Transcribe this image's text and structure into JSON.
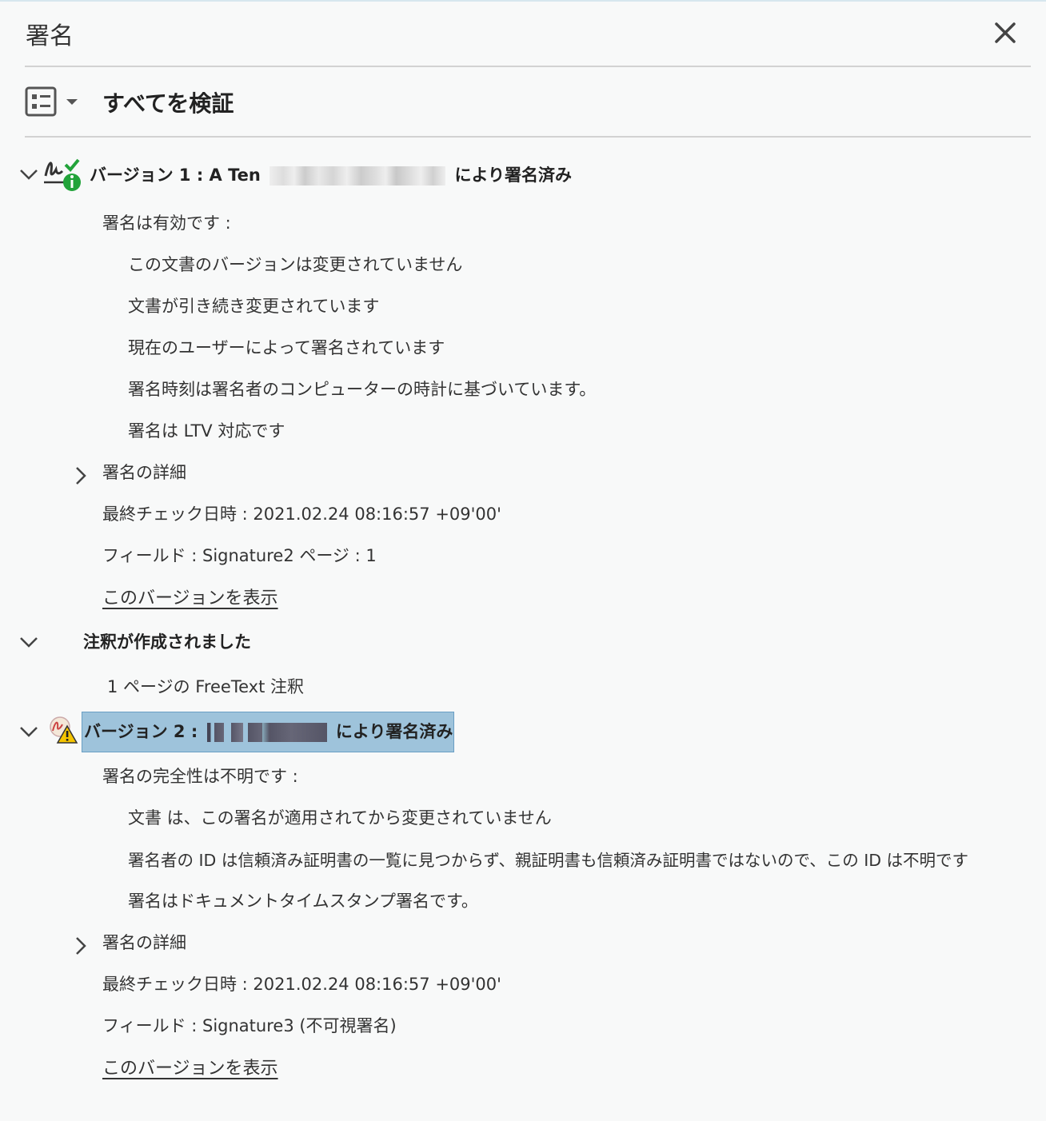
{
  "panel": {
    "title": "署名",
    "close_icon": "close-icon",
    "options_icon": "list-options-icon",
    "verify_all_label": "すべてを検証"
  },
  "version1": {
    "header_prefix": "バージョン 1 : A Ten",
    "header_suffix": "により署名済み",
    "status_icon": "signature-valid-info-icon",
    "validity_heading": "署名は有効です :",
    "details": [
      "この文書のバージョンは変更されていません",
      "文書が引き続き変更されています",
      "現在のユーザーによって署名されています",
      "署名時刻は署名者のコンピューターの時計に基づいています。",
      "署名は LTV 対応です"
    ],
    "signature_details_label": "署名の詳細",
    "last_checked": "最終チェック日時 : 2021.02.24 08:16:57 +09'00'",
    "field": "フィールド : Signature2  ページ : 1",
    "view_version_link": "このバージョンを表示"
  },
  "annotation": {
    "header": "注釈が作成されました",
    "detail": "1 ページの FreeText 注釈"
  },
  "version2": {
    "header_prefix": "バージョン 2 :",
    "header_suffix": "により署名済み",
    "status_icon": "signature-warning-icon",
    "validity_heading": "署名の完全性は不明です :",
    "details": [
      "文書 は、この署名が適用されてから変更されていません",
      "署名者の ID は信頼済み証明書の一覧に見つからず、親証明書も信頼済み証明書ではないので、この ID は不明です",
      "署名はドキュメントタイムスタンプ署名です。"
    ],
    "signature_details_label": "署名の詳細",
    "last_checked": "最終チェック日時 : 2021.02.24 08:16:57 +09'00'",
    "field": "フィールド : Signature3 (不可視署名)",
    "view_version_link": "このバージョンを表示"
  },
  "colors": {
    "selection": "#9ec3db",
    "valid_green": "#22a33a",
    "warning_yellow": "#f5c400"
  }
}
